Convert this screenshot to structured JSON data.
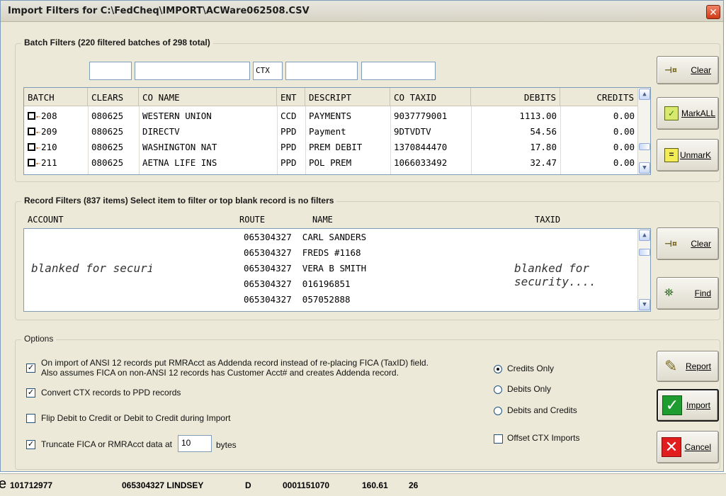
{
  "window": {
    "title": "Import Filters for C:\\FedCheq\\IMPORT\\ACWare062508.CSV",
    "close_glyph": "✕"
  },
  "batch_filters": {
    "label": "Batch Filters (220 filtered batches of 298 total)",
    "filter_inputs": [
      "",
      "",
      "CTX",
      "",
      ""
    ],
    "columns": [
      "BATCH",
      "CLEARS",
      "CO NAME",
      "ENT",
      "DESCRIPT",
      "CO TAXID",
      "DEBITS",
      "CREDITS"
    ],
    "rows": [
      {
        "batch": "208",
        "clears": "080625",
        "co_name": "WESTERN UNION",
        "ent": "CCD",
        "descript": "PAYMENTS",
        "co_taxid": "9037779001",
        "debits": "1113.00",
        "credits": "0.00"
      },
      {
        "batch": "209",
        "clears": "080625",
        "co_name": "DIRECTV",
        "ent": "PPD",
        "descript": "Payment",
        "co_taxid": "9DTVDTV",
        "debits": "54.56",
        "credits": "0.00"
      },
      {
        "batch": "210",
        "clears": "080625",
        "co_name": "WASHINGTON NAT",
        "ent": "PPD",
        "descript": "PREM DEBIT",
        "co_taxid": "1370844470",
        "debits": "17.80",
        "credits": "0.00"
      },
      {
        "batch": "211",
        "clears": "080625",
        "co_name": "AETNA LIFE INS",
        "ent": "PPD",
        "descript": "POL PREM",
        "co_taxid": "1066033492",
        "debits": "32.47",
        "credits": "0.00"
      }
    ],
    "buttons": {
      "clear": "Clear",
      "mark_all": "MarkALL",
      "unmark": "UnmarK"
    }
  },
  "record_filters": {
    "label": "Record Filters (837 items) Select item to filter or top blank record is no filters",
    "columns": {
      "account": "ACCOUNT",
      "route": "ROUTE",
      "name": "NAME",
      "taxid": "TAXID"
    },
    "blanked_text": "blanked for security....",
    "rows": [
      {
        "route": "065304327",
        "name": "CARL SANDERS"
      },
      {
        "route": "065304327",
        "name": "FREDS #1168"
      },
      {
        "route": "065304327",
        "name": "VERA B SMITH"
      },
      {
        "route": "065304327",
        "name": "016196851"
      },
      {
        "route": "065304327",
        "name": "057052888"
      }
    ],
    "buttons": {
      "clear": "Clear",
      "find": "Find"
    }
  },
  "options": {
    "label": "Options",
    "checkboxes": [
      {
        "line1": "On import of ANSI 12 records put RMRAcct as Addenda record instead of re-placing FICA (TaxID) field.",
        "line2": "Also assumes FICA on non-ANSI 12 records has Customer Acct# and creates Addenda record.",
        "checked": true
      },
      {
        "line1": "Convert CTX records to PPD records",
        "checked": true
      },
      {
        "line1": "Flip Debit to Credit or Debit to Credit during Import",
        "checked": false
      },
      {
        "line1": "Truncate FICA or RMRAcct data at",
        "checked": true
      }
    ],
    "truncate_value": "10",
    "truncate_unit": "bytes",
    "radios": [
      {
        "label": "Credits Only",
        "selected": true
      },
      {
        "label": "Debits Only",
        "selected": false
      },
      {
        "label": "Debits and Credits",
        "selected": false
      }
    ],
    "offset_ctx": {
      "label": "Offset CTX Imports",
      "checked": false
    },
    "buttons": {
      "report": "Report",
      "import": "Import",
      "cancel": "Cancel"
    }
  },
  "status_bar": {
    "prefix": "e",
    "fields": [
      "101712977",
      "065304327 LINDSEY",
      "D",
      "0001151070",
      "160.61",
      "26"
    ]
  }
}
